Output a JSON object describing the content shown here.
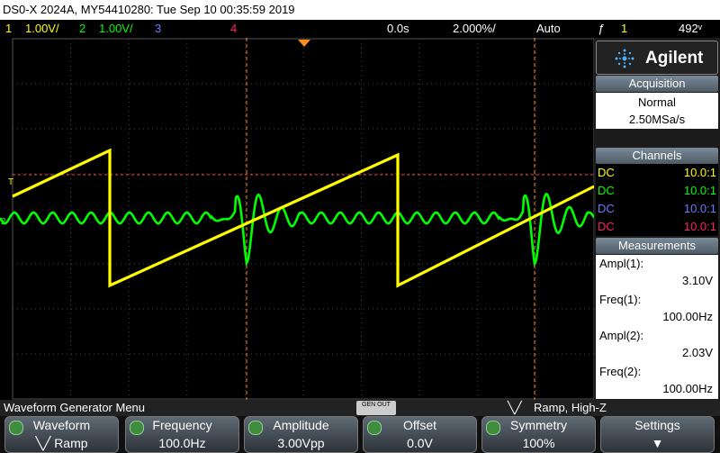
{
  "title": "DS0-X 2024A, MY54410280: Tue Sep 10 00:35:59 2019",
  "status": {
    "ch1_num": "1",
    "ch1_scale": "1.00V/",
    "ch2_num": "2",
    "ch2_scale": "1.00V/",
    "ch3_num": "3",
    "ch4_num": "4",
    "time_offset": "0.0s",
    "timebase": "2.000%/",
    "trigger_mode": "Auto",
    "trigger_symbol": "ƒ",
    "trigger_ch": "1",
    "trigger_level": "492ᵛ"
  },
  "panel": {
    "brand": "Agilent",
    "acq_header": "Acquisition",
    "acq_mode": "Normal",
    "sample_rate": "2.50MSa/s",
    "channels_header": "Channels",
    "channels": [
      {
        "coupling": "DC",
        "ratio": "10.0:1",
        "color": "#ffff00"
      },
      {
        "coupling": "DC",
        "ratio": "10.0:1",
        "color": "#00ff00"
      },
      {
        "coupling": "DC",
        "ratio": "10.0:1",
        "color": "#6a7cff"
      },
      {
        "coupling": "DC",
        "ratio": "10.0:1",
        "color": "#ff1e6e"
      }
    ],
    "meas_header": "Measurements",
    "measurements": [
      {
        "label": "Ampl(1):",
        "value": "3.10V"
      },
      {
        "label": "Freq(1):",
        "value": "100.00Hz"
      },
      {
        "label": "Ampl(2):",
        "value": "2.03V"
      },
      {
        "label": "Freq(2):",
        "value": "100.00Hz"
      }
    ]
  },
  "menu": {
    "title": "Waveform Generator Menu",
    "gen_out": "GEN OUT",
    "wave_summary": "Ramp, High-Z",
    "keys": [
      {
        "top": "Waveform",
        "bottom": "Ramp"
      },
      {
        "top": "Frequency",
        "bottom": "100.0Hz"
      },
      {
        "top": "Amplitude",
        "bottom": "3.00Vpp"
      },
      {
        "top": "Offset",
        "bottom": "0.0V"
      },
      {
        "top": "Symmetry",
        "bottom": "100%"
      },
      {
        "top": "Settings",
        "bottom": ""
      }
    ]
  },
  "colors": {
    "ch1": "#ffff00",
    "ch2": "#00ff00",
    "ch3": "#6a7cff",
    "ch4": "#ff1e6e",
    "cursor": "#ff8c1a",
    "trigger": "#ff4040"
  }
}
